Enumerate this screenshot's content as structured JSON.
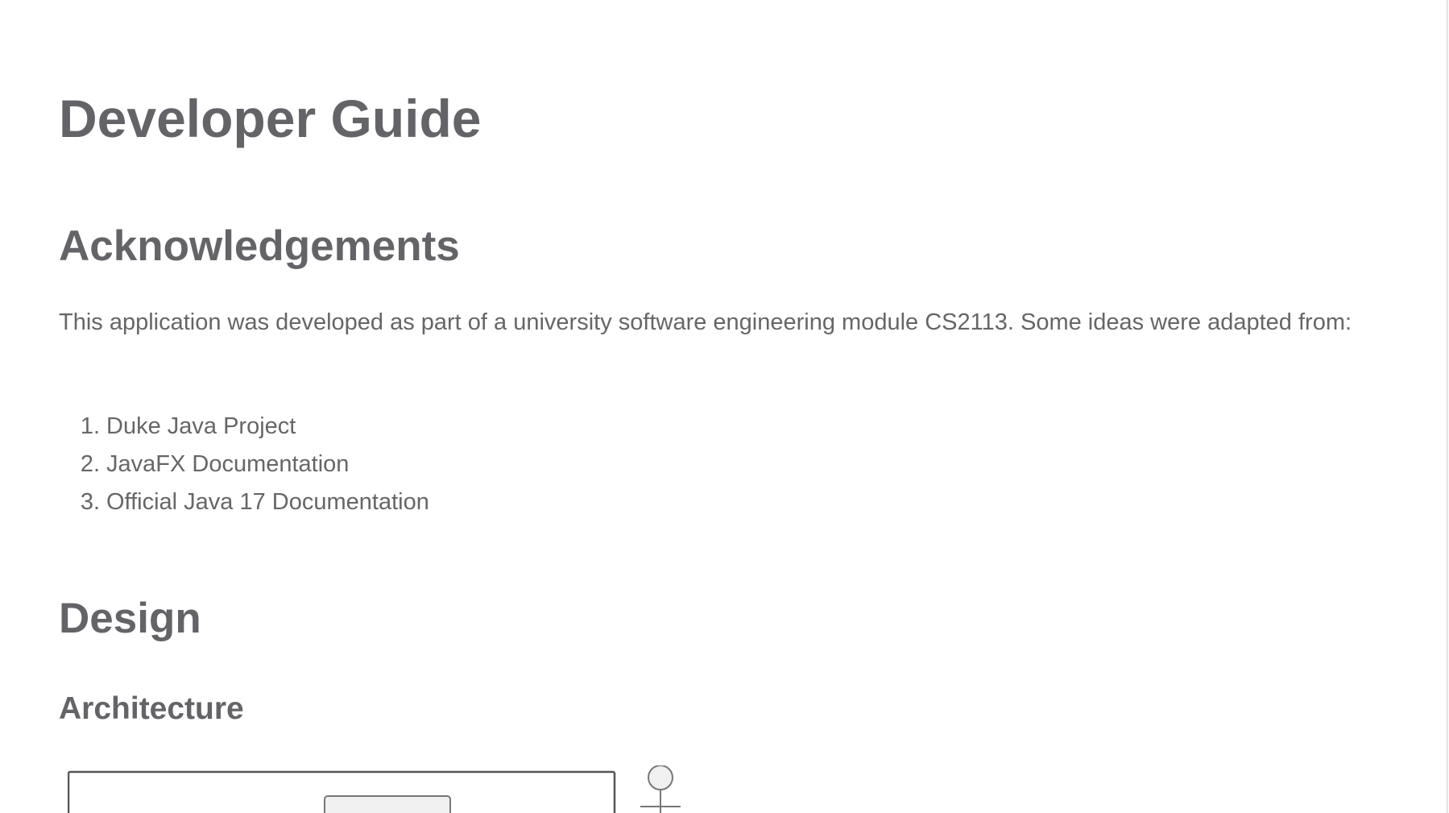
{
  "doc": {
    "title": "Developer Guide",
    "acknowledgements": {
      "heading": "Acknowledgements",
      "intro": "This application was developed as part of a university software engineering module CS2113. Some ideas were adapted from:",
      "items": [
        {
          "num": "1.",
          "text": "Duke Java Project"
        },
        {
          "num": "2.",
          "text": "JavaFX Documentation"
        },
        {
          "num": "3.",
          "text": "Official Java 17 Documentation"
        }
      ]
    },
    "design": {
      "heading": "Design",
      "architecture": {
        "heading": "Architecture"
      }
    }
  },
  "colors": {
    "text": "#666669",
    "heading": "#646468",
    "background": "#ffffff",
    "diagram_stroke": "#555555",
    "diagram_fill": "#f0f0f0"
  }
}
